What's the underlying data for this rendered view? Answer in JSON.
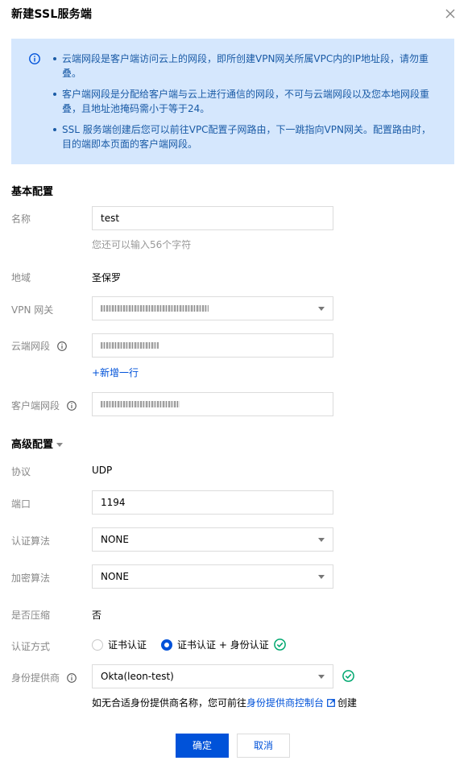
{
  "dialog": {
    "title": "新建SSL服务端",
    "close_icon": "close-icon"
  },
  "notice": {
    "icon": "info-icon",
    "items": [
      "云端网段是客户端访问云上的网段，即所创建VPN网关所属VPC内的IP地址段，请勿重叠。",
      "客户端网段是分配给客户端与云上进行通信的网段，不可与云端网段以及您本地网段重叠，且地址池掩码需小于等于24。",
      "SSL 服务端创建后您可以前往VPC配置子网路由，下一跳指向VPN网关。配置路由时，目的端即本页面的客户端网段。"
    ]
  },
  "basic": {
    "title": "基本配置",
    "name_label": "名称",
    "name_value": "test",
    "name_hint": "您还可以输入56个字符",
    "region_label": "地域",
    "region_value": "圣保罗",
    "vpn_label": "VPN 网关",
    "cloud_cidr_label": "云端网段",
    "add_row_link": "+新增一行",
    "client_cidr_label": "客户端网段"
  },
  "advanced": {
    "title": "高级配置",
    "protocol_label": "协议",
    "protocol_value": "UDP",
    "port_label": "端口",
    "port_value": "1194",
    "auth_algo_label": "认证算法",
    "auth_algo_value": "NONE",
    "encrypt_algo_label": "加密算法",
    "encrypt_algo_value": "NONE",
    "compress_label": "是否压缩",
    "compress_value": "否",
    "auth_mode_label": "认证方式",
    "auth_mode_options": [
      "证书认证",
      "证书认证 + 身份认证"
    ],
    "auth_mode_selected": "证书认证 + 身份认证",
    "idp_label": "身份提供商",
    "idp_value": "Okta(leon-test)",
    "idp_note_prefix": "如无合适身份提供商名称，您可前往",
    "idp_note_link": "身份提供商控制台",
    "idp_note_suffix": "创建"
  },
  "footer": {
    "confirm_label": "确定",
    "cancel_label": "取消"
  },
  "colors": {
    "accent": "#0052d9",
    "notice_bg": "#d5e7fd",
    "success": "#00a870"
  }
}
